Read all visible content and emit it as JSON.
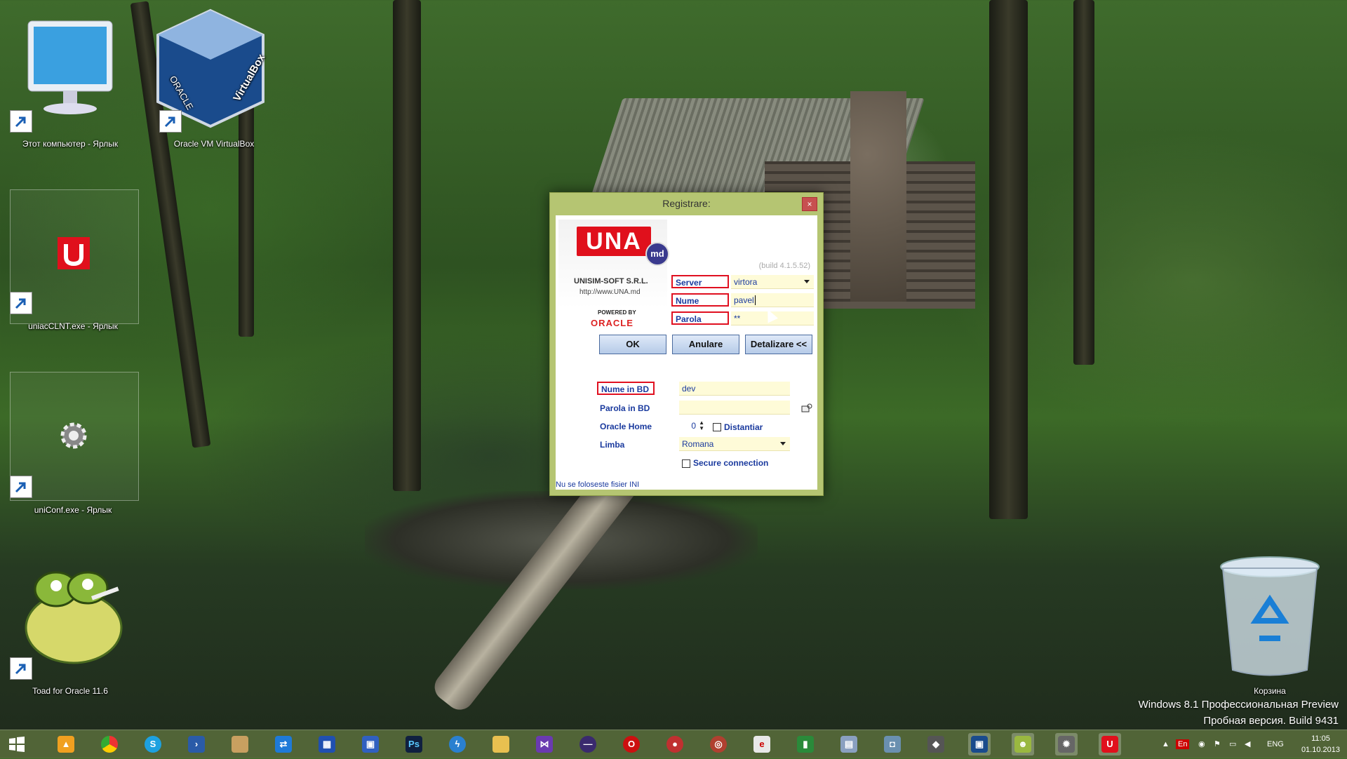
{
  "desktop": {
    "icons": [
      {
        "label": "Этот компьютер - Ярлык"
      },
      {
        "label": "Oracle VM VirtualBox"
      },
      {
        "label": "uniacCLNT.exe - Ярлык"
      },
      {
        "label": "uniConf.exe - Ярлык"
      },
      {
        "label": "Toad for Oracle 11.6"
      },
      {
        "label": "Корзина"
      }
    ],
    "watermark": {
      "line1": "Windows 8.1 Профессиональная Preview",
      "line2": "Пробная версия. Build 9431"
    }
  },
  "dialog": {
    "title": "Registrare:",
    "close_glyph": "×",
    "logo_text": "UNA",
    "logo_badge": "md",
    "company": "UNISIM-SOFT S.R.L.",
    "url": "http://www.UNA.md",
    "powered_by": "POWERED BY",
    "oracle": "ORACLE",
    "build": "(build 4.1.5.52)",
    "server_label": "Server",
    "server_value": "virtora",
    "name_label": "Nume",
    "name_value": "pavel",
    "password_label": "Parola",
    "password_value": "**",
    "ok_button": "OK",
    "cancel_button": "Anulare",
    "details_button": "Detalizare <<",
    "db_name_label": "Nume in BD",
    "db_name_value": "dev",
    "db_password_label": "Parola in BD",
    "db_password_value": "",
    "oracle_home_label": "Oracle Home",
    "oracle_home_value": "0",
    "remote_label": "Distantiar",
    "language_label": "Limba",
    "language_value": "Romana",
    "secure_label": "Secure connection",
    "ini_status": "Nu se foloseste fisier INI"
  },
  "taskbar": {
    "tray": {
      "lang_badge": "En",
      "lang": "ENG",
      "time": "11:05",
      "date": "01.10.2013"
    }
  }
}
